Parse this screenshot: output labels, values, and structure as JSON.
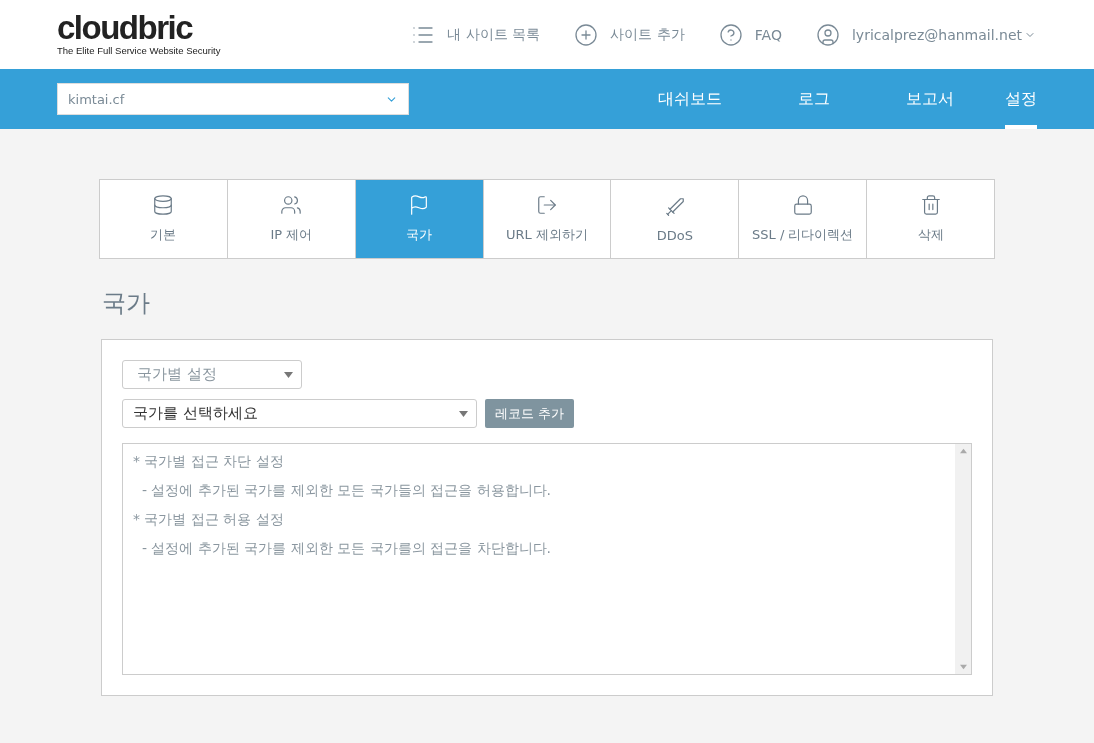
{
  "logo": {
    "name": "cloudbric",
    "tagline": "The Elite Full Service Website Security"
  },
  "top_links": [
    {
      "kind": "list",
      "label": "내 사이트 목록"
    },
    {
      "kind": "add",
      "label": "사이트 추가"
    },
    {
      "kind": "help",
      "label": "FAQ"
    },
    {
      "kind": "user",
      "label": "lyricalprez@hanmail.net"
    }
  ],
  "site_select": {
    "value": "kimtai.cf"
  },
  "nav": [
    {
      "label": "대쉬보드",
      "selected": false
    },
    {
      "label": "로그",
      "selected": false
    },
    {
      "label": "보고서",
      "selected": false
    },
    {
      "label": "설정",
      "selected": true
    }
  ],
  "tabs": [
    {
      "kind": "stack",
      "label": "기본",
      "selected": false
    },
    {
      "kind": "users",
      "label": "IP 제어",
      "selected": false
    },
    {
      "kind": "flag",
      "label": "국가",
      "selected": true
    },
    {
      "kind": "exit",
      "label": "URL 제외하기",
      "selected": false
    },
    {
      "kind": "sword",
      "label": "DDoS",
      "selected": false
    },
    {
      "kind": "lock",
      "label": "SSL / 리다이렉션",
      "selected": false
    },
    {
      "kind": "trash",
      "label": "삭제",
      "selected": false
    }
  ],
  "heading": "국가",
  "mode_select": {
    "value": "국가별 설정"
  },
  "country_select": {
    "value": "국가를 선택하세요"
  },
  "add_button": "레코드 추가",
  "notes": [
    "* 국가별 접근 차단 설정",
    "  - 설정에 추가된 국가를 제외한 모든 국가들의 접근을 허용합니다.",
    "* 국가별 접근 허용 설정",
    "  - 설정에 추가된 국가를 제외한 모든 국가를의 접근을 차단합니다."
  ]
}
